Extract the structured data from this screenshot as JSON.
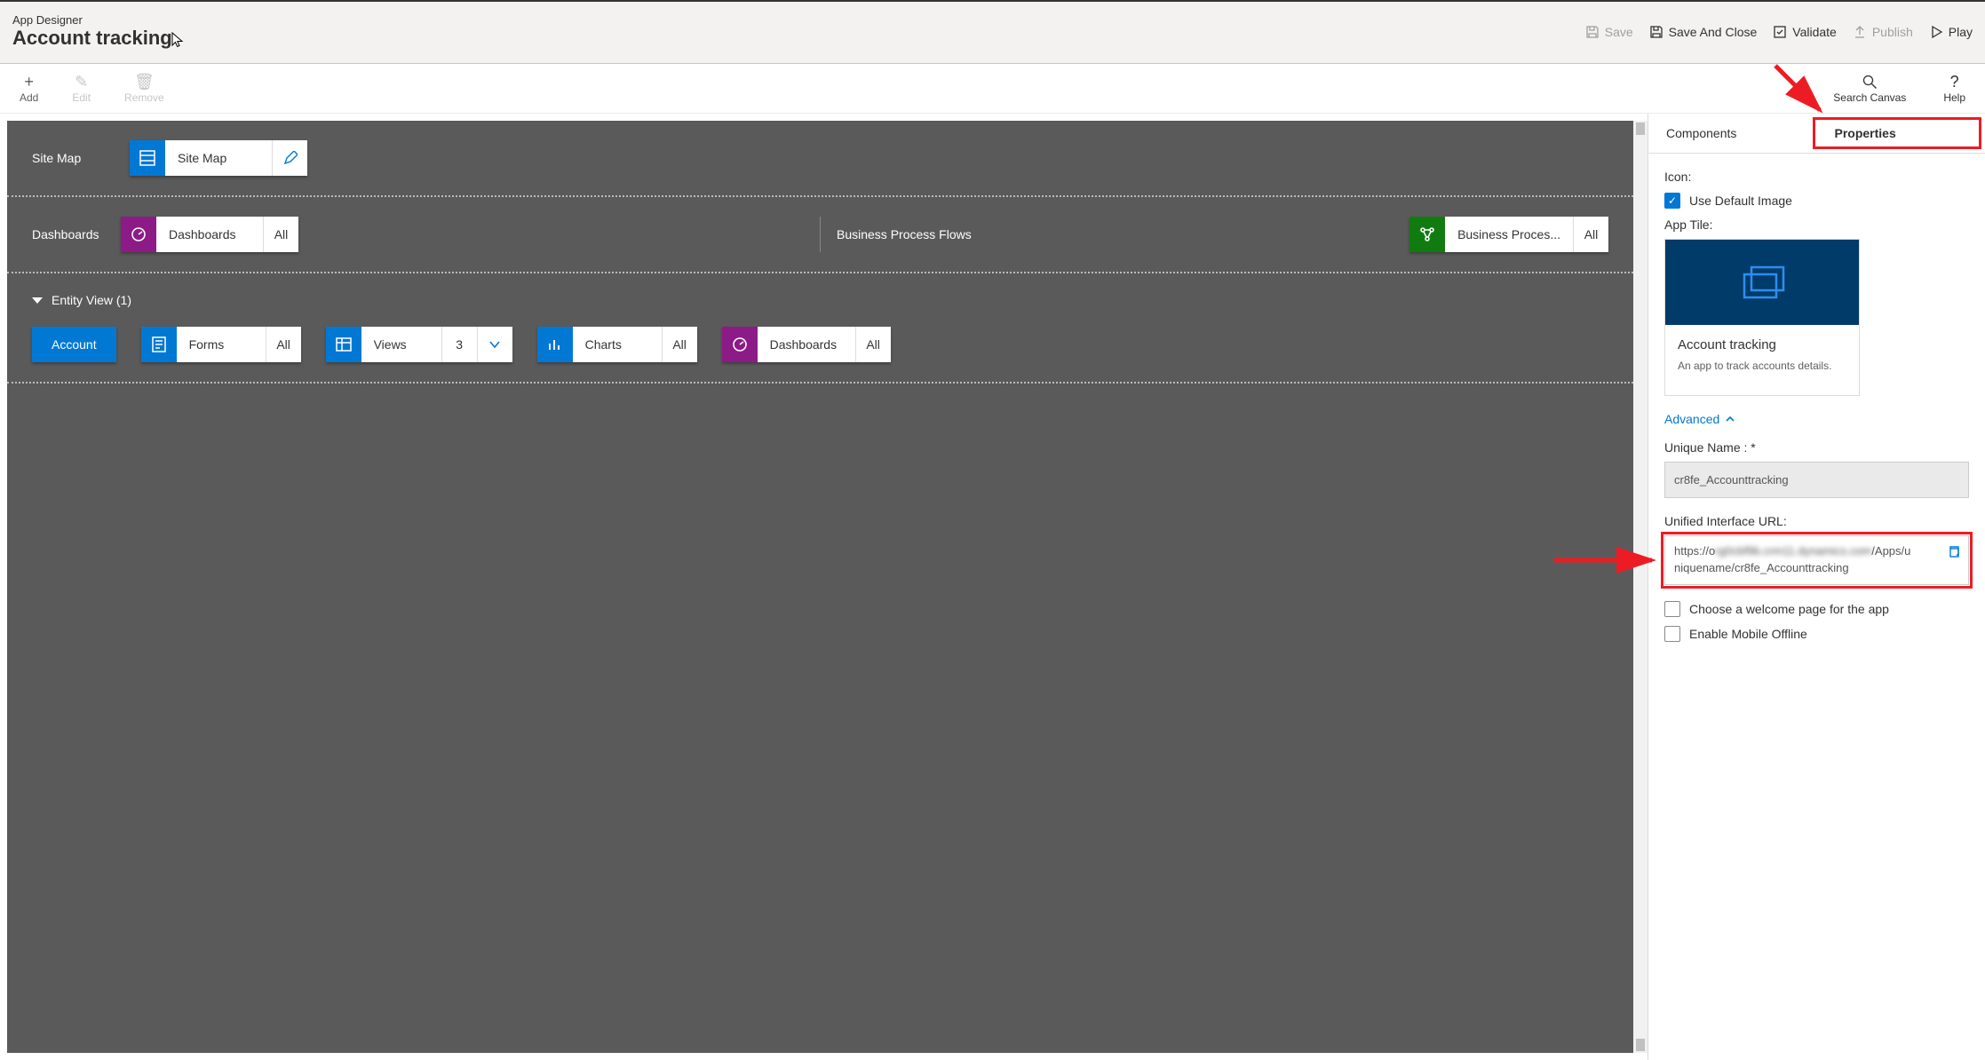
{
  "header": {
    "designer_label": "App Designer",
    "app_name": "Account tracking",
    "buttons": {
      "save": "Save",
      "save_close": "Save And Close",
      "validate": "Validate",
      "publish": "Publish",
      "play": "Play"
    }
  },
  "toolbar": {
    "add": "Add",
    "edit": "Edit",
    "remove": "Remove",
    "search": "Search Canvas",
    "help": "Help"
  },
  "canvas": {
    "sitemap": {
      "row_label": "Site Map",
      "tile_label": "Site Map"
    },
    "dashboards": {
      "row_label": "Dashboards",
      "tile_label": "Dashboards",
      "count": "All"
    },
    "bpf": {
      "row_label": "Business Process Flows",
      "tile_label": "Business Proces...",
      "count": "All"
    },
    "entity_view": {
      "header": "Entity View (1)",
      "entity_name": "Account"
    },
    "forms": {
      "label": "Forms",
      "count": "All"
    },
    "views": {
      "label": "Views",
      "count": "3"
    },
    "charts": {
      "label": "Charts",
      "count": "All"
    },
    "ent_dashboards": {
      "label": "Dashboards",
      "count": "All"
    }
  },
  "panel": {
    "tab_components": "Components",
    "tab_properties": "Properties",
    "icon_label": "Icon:",
    "use_default_image": "Use Default Image",
    "app_tile_label": "App Tile:",
    "app_tile_title": "Account tracking",
    "app_tile_desc": "An app to track accounts details.",
    "advanced": "Advanced",
    "unique_name_label": "Unique Name : *",
    "unique_name_value": "cr8fe_Accounttracking",
    "url_label": "Unified Interface URL:",
    "url_prefix": "https://o",
    "url_mid": "rg0cbf9b.crm11.dynamics.com",
    "url_suffix1": "/Apps/u",
    "url_suffix2": "niquename/cr8fe_Accounttracking",
    "chk_welcome": "Choose a welcome page for the app",
    "chk_offline": "Enable Mobile Offline"
  }
}
